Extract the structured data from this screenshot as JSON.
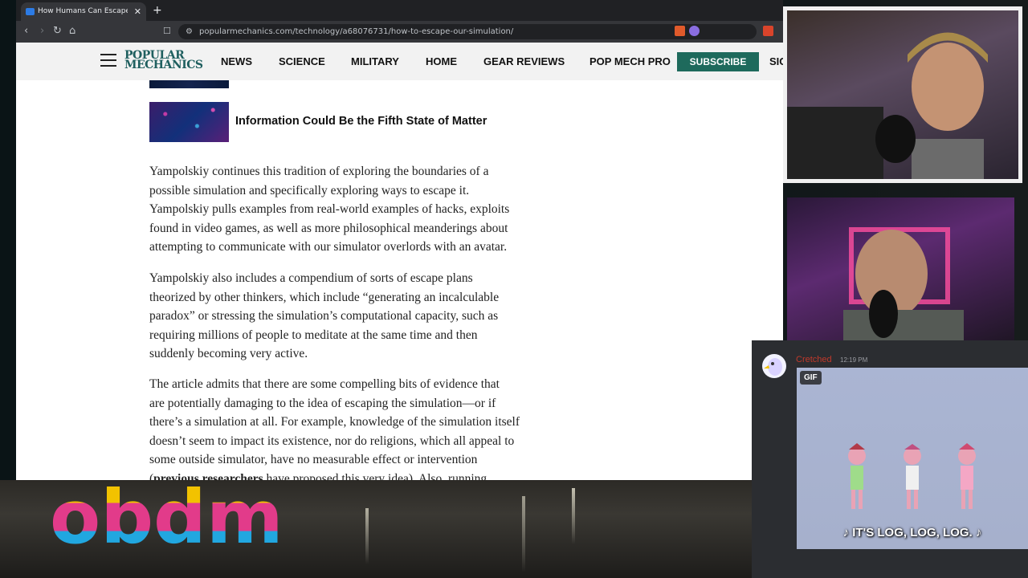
{
  "browser": {
    "tab_title": "How Humans Can Escape the Sim",
    "new_tab": "+",
    "url": "popularmechanics.com/technology/a68076731/how-to-escape-our-simulation/"
  },
  "site": {
    "logo_line1": "POPULAR",
    "logo_line2": "MECHANICS",
    "nav": [
      "NEWS",
      "SCIENCE",
      "MILITARY",
      "HOME",
      "GEAR REVIEWS",
      "POP MECH PRO"
    ],
    "subscribe": "SUBSCRIBE",
    "signin": "SIG"
  },
  "article": {
    "related_title": "Information Could Be the Fifth State of Matter",
    "paragraphs": [
      [
        "Yampolskiy continues this tradition of exploring the boundaries of a",
        "possible simulation and specifically exploring ways to escape it.",
        "Yampolskiy pulls examples from real-world examples of hacks, exploits",
        "found in video games, as well as more philosophical meanderings about",
        "attempting to communicate with our simulator overlords with an avatar."
      ],
      [
        "Yampolskiy also includes a compendium of sorts of escape plans",
        "theorized by other thinkers, which include “generating an incalculable",
        "paradox” or stressing the simulation’s computational capacity, such as",
        "requiring millions of people to meditate at the same time and then",
        "suddenly becoming very active."
      ],
      [
        "The article admits that there are some compelling bits of evidence that",
        "are potentially damaging to the idea of escaping the simulation—or if",
        "there’s a simulation at all. For example, knowledge of the simulation itself",
        "doesn’t seem to impact its existence, nor do religions, which all appeal to",
        "some outside simulator, have no measurable effect or intervention"
      ]
    ],
    "last_line_bold": "previous researchers",
    "last_line_rest": " have proposed this very idea). Also, running"
  },
  "overlay": {
    "brand": "obdm"
  },
  "chat": {
    "username": "Cretched",
    "time": "12:19 PM",
    "gif_badge": "GIF",
    "gif_caption": "♪ IT'S LOG, LOG, LOG. ♪"
  }
}
